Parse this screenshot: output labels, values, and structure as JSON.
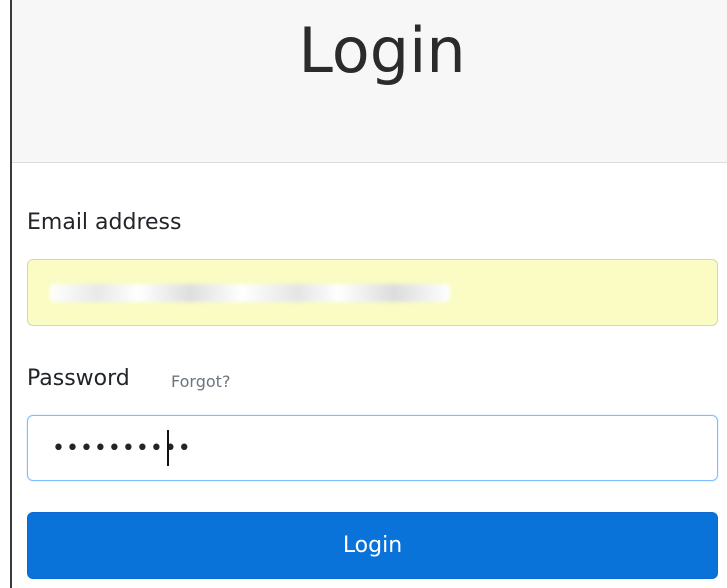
{
  "page": {
    "title": "Login"
  },
  "form": {
    "email_label": "Email address",
    "email_value": "",
    "password_label": "Password",
    "forgot_label": "Forgot?",
    "password_value": "••••••••••",
    "submit_label": "Login"
  },
  "colors": {
    "email_autofill_bg": "#fafcc4",
    "button_bg": "#0a73d9",
    "focus_border": "#80bdff",
    "header_bg": "#f7f7f7",
    "muted_link": "#6c757d"
  }
}
